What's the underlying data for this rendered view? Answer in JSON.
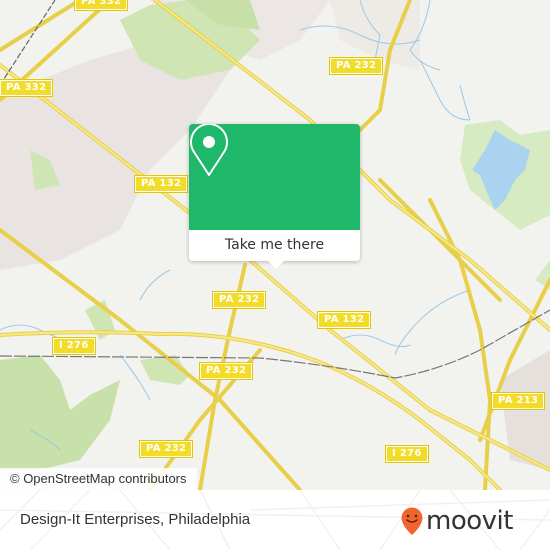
{
  "map": {
    "road_labels": [
      {
        "id": "pa332-top",
        "text": "PA 332"
      },
      {
        "id": "pa232-top",
        "text": "PA 232"
      },
      {
        "id": "pa332-left",
        "text": "PA 332"
      },
      {
        "id": "pa132-left",
        "text": "PA 132"
      },
      {
        "id": "pa232-mid",
        "text": "PA 232"
      },
      {
        "id": "pa132-right",
        "text": "PA 132"
      },
      {
        "id": "i276-left",
        "text": "I 276"
      },
      {
        "id": "pa232-lower",
        "text": "PA 232"
      },
      {
        "id": "pa232-bottom",
        "text": "PA 232"
      },
      {
        "id": "i276-right",
        "text": "I 276"
      },
      {
        "id": "pa213",
        "text": "PA 213"
      }
    ],
    "attribution": "© OpenStreetMap contributors",
    "colors": {
      "land": "#f2f2ee",
      "park": "#cfe6b4",
      "residential": "#e9e4e1",
      "water": "#aad3ef",
      "road": "#f2dc5d",
      "shield": "#f2dc27"
    }
  },
  "popup": {
    "icon": "location-pin-icon",
    "action_label": "Take me there",
    "color": "#1fb76a"
  },
  "footer": {
    "place_name": "Design-It Enterprises, Philadelphia",
    "brand": "moovit",
    "brand_icon": "moovit-smiley-pin-icon",
    "brand_color": "#f0642d"
  }
}
